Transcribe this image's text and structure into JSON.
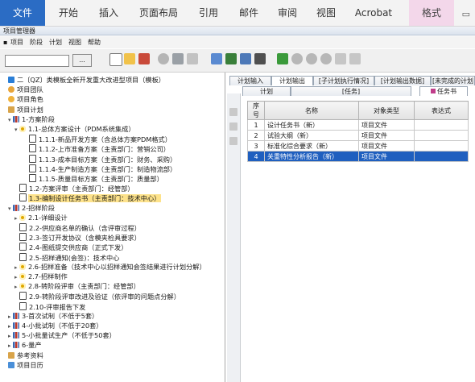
{
  "ribbon": {
    "tabs": [
      "文件",
      "开始",
      "插入",
      "页面布局",
      "引用",
      "邮件",
      "审阅",
      "视图",
      "Acrobat",
      "格式"
    ]
  },
  "window": {
    "title": "项目管理器"
  },
  "menu": [
    "项目",
    "阶段",
    "计划",
    "视图",
    "帮助"
  ],
  "search": {
    "value": "",
    "button": "..."
  },
  "tree": [
    {
      "label": "二〔QZ〕类模板全新开发重大改进型项目（模板）",
      "icon": "flag",
      "depth": 0
    },
    {
      "label": "项目团队",
      "icon": "team",
      "depth": 0
    },
    {
      "label": "项目角色",
      "icon": "role",
      "depth": 0
    },
    {
      "label": "项目计划",
      "icon": "plan",
      "depth": 0
    },
    {
      "label": "1-方案阶段",
      "icon": "bar",
      "depth": 1,
      "toggle": "▾"
    },
    {
      "label": "1.1-总体方案设计（PDM系统集成）",
      "icon": "gear",
      "depth": 2,
      "toggle": "▾"
    },
    {
      "label": "1.1.1-新品开发方案（含总体方案PDM格式）",
      "icon": "doc",
      "depth": 3
    },
    {
      "label": "1.1.2-上市准备方案（主责部门：营销公司）",
      "icon": "doc",
      "depth": 3
    },
    {
      "label": "1.1.3-成本目标方案（主责部门：财务、采购）",
      "icon": "doc",
      "depth": 3
    },
    {
      "label": "1.1.4-生产制造方案（主责部门：制造物流部）",
      "icon": "doc",
      "depth": 3
    },
    {
      "label": "1.1.5-质量目标方案（主责部门：质量部）",
      "icon": "doc",
      "depth": 3
    },
    {
      "label": "1.2-方案评审（主责部门：经管部）",
      "icon": "doc",
      "depth": 2
    },
    {
      "label": "1.3-编制设计任务书（主责部门：技术中心）",
      "icon": "doc",
      "depth": 2,
      "selected": true
    },
    {
      "label": "2-招样阶段",
      "icon": "bar",
      "depth": 1,
      "toggle": "▾"
    },
    {
      "label": "2.1-详细设计",
      "icon": "gear",
      "depth": 2,
      "toggle": "▸"
    },
    {
      "label": "2.2-供应商名单的确认（含评审过程）",
      "icon": "doc",
      "depth": 2
    },
    {
      "label": "2.3-签订开发协议（含模夹检具要求）",
      "icon": "doc",
      "depth": 2
    },
    {
      "label": "2.4-图纸提交供应商（正式下发）",
      "icon": "doc",
      "depth": 2
    },
    {
      "label": "2.5-招样通知(会签)：技术中心",
      "icon": "doc",
      "depth": 2
    },
    {
      "label": "2.6-招样准备（技术中心以招样通知会签结果进行计划分解）",
      "icon": "gear",
      "depth": 2,
      "toggle": "▸"
    },
    {
      "label": "2.7-招样制作",
      "icon": "gear",
      "depth": 2,
      "toggle": "▸"
    },
    {
      "label": "2.8-转阶段评审（主责部门：经管部）",
      "icon": "gear",
      "depth": 2,
      "toggle": "▸"
    },
    {
      "label": "2.9-转阶段评审改进及验证（依评审的问题点分解）",
      "icon": "doc",
      "depth": 2
    },
    {
      "label": "2.10-评审报告下发",
      "icon": "doc",
      "depth": 2
    },
    {
      "label": "3-首次试制（不低于5套）",
      "icon": "bar",
      "depth": 1,
      "toggle": "▸"
    },
    {
      "label": "4-小批试制（不低于20套）",
      "icon": "bar",
      "depth": 1,
      "toggle": "▸"
    },
    {
      "label": "5-小批量试生产（不低于50套）",
      "icon": "bar",
      "depth": 1,
      "toggle": "▸"
    },
    {
      "label": "6-量产",
      "icon": "bar",
      "depth": 1,
      "toggle": "▸"
    },
    {
      "label": "参考资料",
      "icon": "plan",
      "depth": 0
    },
    {
      "label": "项目日历",
      "icon": "cal",
      "depth": 0
    }
  ],
  "panel": {
    "tabs_top": [
      "计划输入",
      "计划输出",
      "[子计划执行情况]",
      "[计划输出数据]",
      "[未完成的计划"
    ],
    "tabs_sub": [
      "计划",
      "[任务]",
      "任务书"
    ],
    "columns": [
      "序号",
      "名称",
      "对象类型",
      "表达式"
    ],
    "rows": [
      {
        "no": "1",
        "name": "设计任务书（新）",
        "type": "项目文件",
        "expr": ""
      },
      {
        "no": "2",
        "name": "试验大纲（新）",
        "type": "项目文件",
        "expr": ""
      },
      {
        "no": "3",
        "name": "标准化综合要求（新）",
        "type": "项目文件",
        "expr": ""
      },
      {
        "no": "4",
        "name": "关重特性分析报告（新）",
        "type": "项目文件",
        "expr": ""
      }
    ]
  },
  "colors": {
    "accent": "#2b6cc4",
    "selection": "#1f5fbf",
    "tree_selection": "#fde28b"
  }
}
